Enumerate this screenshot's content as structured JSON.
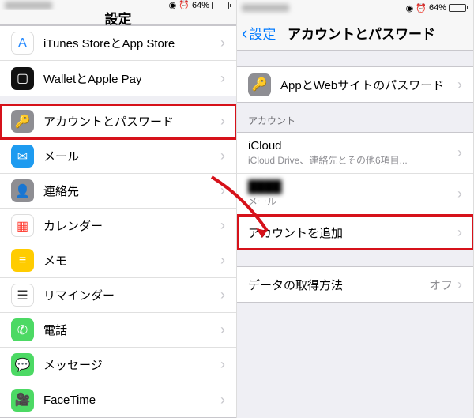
{
  "status": {
    "battery_pct": "64%",
    "icons": "◉ ⏰"
  },
  "left": {
    "title": "設定",
    "rows1": [
      {
        "label": "iTunes StoreとApp Store",
        "icon_bg": "#ffffff",
        "icon_fg": "#1e86ff",
        "icon": "A",
        "name": "itunes-appstore"
      },
      {
        "label": "WalletとApple Pay",
        "icon_bg": "#111",
        "icon_fg": "#fff",
        "icon": "▢",
        "name": "wallet-applepay"
      }
    ],
    "rows2": [
      {
        "label": "アカウントとパスワード",
        "icon_bg": "#8e8e93",
        "icon_fg": "#fff",
        "icon": "🔑",
        "name": "accounts-passwords",
        "highlight": true
      },
      {
        "label": "メール",
        "icon_bg": "#1e9bf0",
        "icon_fg": "#fff",
        "icon": "✉",
        "name": "mail"
      },
      {
        "label": "連絡先",
        "icon_bg": "#8e8e93",
        "icon_fg": "#fff",
        "icon": "👤",
        "name": "contacts"
      },
      {
        "label": "カレンダー",
        "icon_bg": "#fff",
        "icon_fg": "#ff3b30",
        "icon": "▦",
        "name": "calendar"
      },
      {
        "label": "メモ",
        "icon_bg": "#ffcc00",
        "icon_fg": "#fff",
        "icon": "≡",
        "name": "notes"
      },
      {
        "label": "リマインダー",
        "icon_bg": "#fff",
        "icon_fg": "#333",
        "icon": "☰",
        "name": "reminders"
      },
      {
        "label": "電話",
        "icon_bg": "#4cd964",
        "icon_fg": "#fff",
        "icon": "✆",
        "name": "phone"
      },
      {
        "label": "メッセージ",
        "icon_bg": "#4cd964",
        "icon_fg": "#fff",
        "icon": "💬",
        "name": "messages"
      },
      {
        "label": "FaceTime",
        "icon_bg": "#4cd964",
        "icon_fg": "#fff",
        "icon": "🎥",
        "name": "facetime"
      }
    ]
  },
  "right": {
    "back": "設定",
    "title": "アカウントとパスワード",
    "app_web_pw": {
      "label": "AppとWebサイトのパスワード",
      "icon_bg": "#8e8e93",
      "icon": "🔑"
    },
    "section_accounts": "アカウント",
    "icloud": {
      "label": "iCloud",
      "sub": "iCloud Drive、連絡先とその他6項目..."
    },
    "hidden_account": {
      "label": "████",
      "sub": "メール"
    },
    "add_account": "アカウントを追加",
    "fetch": {
      "label": "データの取得方法",
      "value": "オフ"
    }
  }
}
